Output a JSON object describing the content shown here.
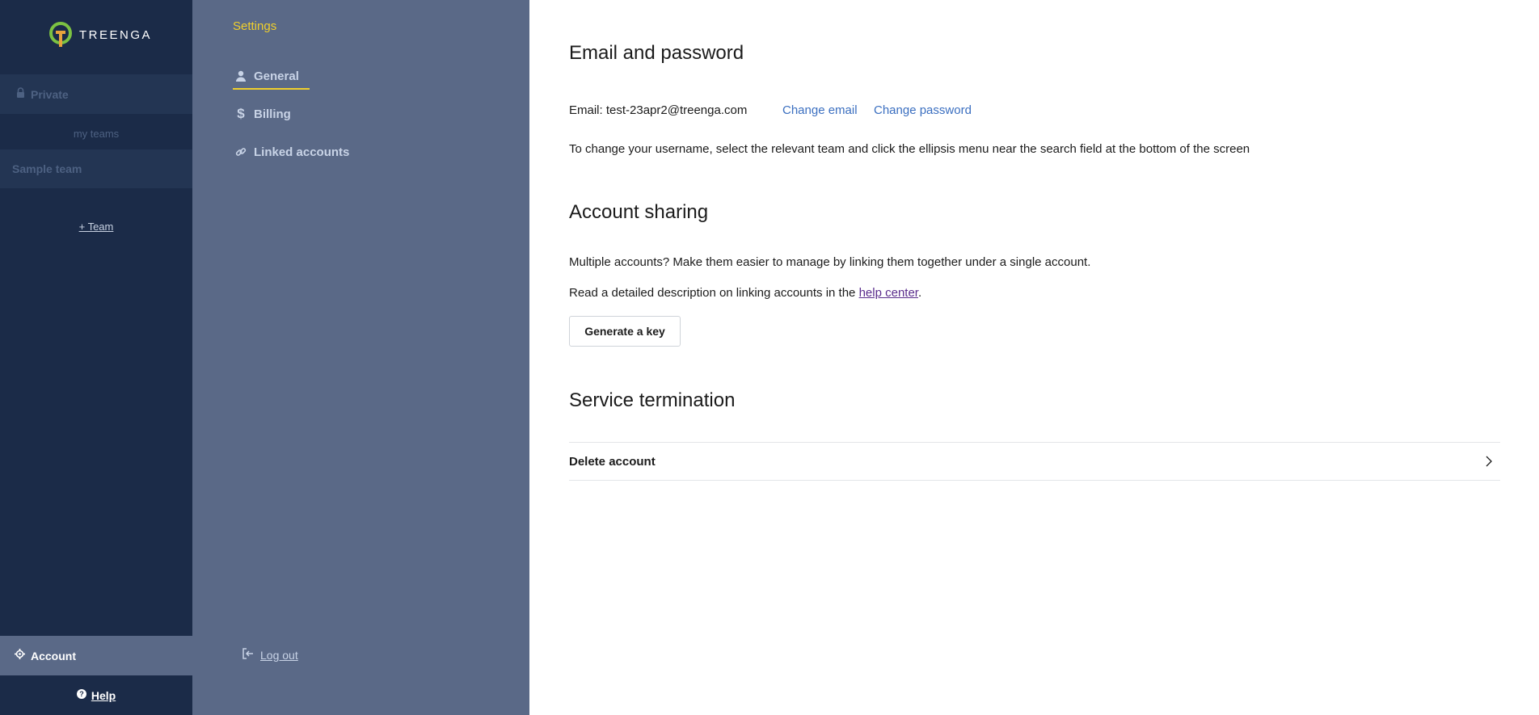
{
  "brand": {
    "name": "TREENGA",
    "logo_colors": {
      "ring": "#7cc242",
      "stem": "#e8a33c"
    }
  },
  "sidebar": {
    "private_label": "Private",
    "my_teams_label": "my teams",
    "teams": [
      {
        "label": "Sample team"
      }
    ],
    "add_team_label": "+ Team",
    "account_label": "Account",
    "help_label": "Help"
  },
  "settings_nav": {
    "title": "Settings",
    "items": [
      {
        "label": "General",
        "icon": "user-icon",
        "active": true
      },
      {
        "label": "Billing",
        "icon": "dollar-icon",
        "active": false
      },
      {
        "label": "Linked accounts",
        "icon": "link-icon",
        "active": false
      }
    ],
    "logout_label": "Log out"
  },
  "main": {
    "email_section": {
      "title": "Email and password",
      "email_text": "Email: test-23apr2@treenga.com",
      "change_email": "Change email",
      "change_password": "Change password",
      "username_note": "To change your username, select the relevant team and click the ellipsis menu near the search field at the bottom of the screen"
    },
    "sharing_section": {
      "title": "Account sharing",
      "description": "Multiple accounts? Make them easier to manage by linking them together under a single account.",
      "read_prefix": "Read a detailed description on linking accounts in the",
      "help_center_link": "help center",
      "read_suffix": ".",
      "generate_key_button": "Generate a key"
    },
    "termination_section": {
      "title": "Service termination",
      "delete_account": "Delete account"
    }
  },
  "colors": {
    "sidebar_bg": "#1b2b48",
    "settings_bg": "#5a6987",
    "accent_yellow": "#f0cf2c",
    "link_blue": "#3b6fc0"
  }
}
